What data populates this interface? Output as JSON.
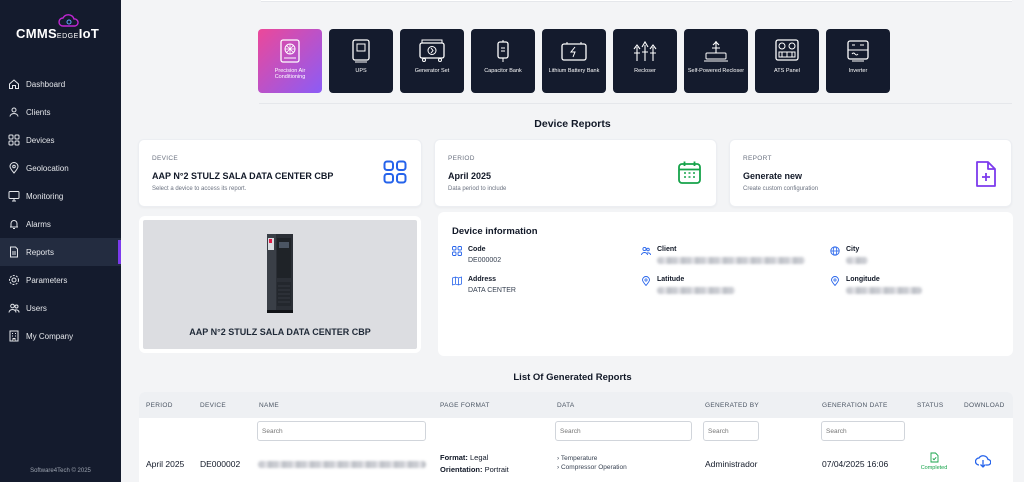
{
  "brand": {
    "name_left": "CMMS",
    "name_edge": "EDGE",
    "name_right": "IoT"
  },
  "sidebar": {
    "items": [
      {
        "label": "Dashboard",
        "icon": "home-icon"
      },
      {
        "label": "Clients",
        "icon": "clients-icon"
      },
      {
        "label": "Devices",
        "icon": "grid-icon"
      },
      {
        "label": "Geolocation",
        "icon": "location-pin-icon"
      },
      {
        "label": "Monitoring",
        "icon": "monitor-icon"
      },
      {
        "label": "Alarms",
        "icon": "alarm-icon"
      },
      {
        "label": "Reports",
        "icon": "file-icon",
        "active": true
      },
      {
        "label": "Parameters",
        "icon": "gear-icon"
      },
      {
        "label": "Users",
        "icon": "users-icon"
      },
      {
        "label": "My Company",
        "icon": "building-icon"
      }
    ],
    "footer": "Software4Tech © 2025"
  },
  "device_types": [
    {
      "label": "Precision Air Conditioning",
      "icon": "air-conditioning-icon",
      "active": true
    },
    {
      "label": "UPS",
      "icon": "ups-icon"
    },
    {
      "label": "Generator Set",
      "icon": "generator-icon"
    },
    {
      "label": "Capacitor Bank",
      "icon": "capacitor-icon"
    },
    {
      "label": "Lithium Battery Bank",
      "icon": "battery-icon"
    },
    {
      "label": "Recloser",
      "icon": "recloser-icon"
    },
    {
      "label": "Self-Powered Recloser",
      "icon": "self-powered-recloser-icon"
    },
    {
      "label": "ATS Panel",
      "icon": "ats-panel-icon"
    },
    {
      "label": "Inverter",
      "icon": "inverter-icon"
    }
  ],
  "reports": {
    "title": "Device Reports",
    "device_card": {
      "key": "DEVICE",
      "value": "AAP N°2 STULZ SALA DATA CENTER CBP",
      "sub": "Select a device to access its report."
    },
    "period_card": {
      "key": "PERIOD",
      "value": "April 2025",
      "sub": "Data period to include"
    },
    "report_card": {
      "key": "REPORT",
      "value": "Generate new",
      "sub": "Create custom configuration"
    }
  },
  "device_image_name": "AAP N°2 STULZ SALA DATA CENTER CBP",
  "device_info": {
    "title": "Device information",
    "code_label": "Code",
    "code_value": "DE000002",
    "client_label": "Client",
    "city_label": "City",
    "address_label": "Address",
    "address_value": "DATA CENTER",
    "latitude_label": "Latitude",
    "longitude_label": "Longitude"
  },
  "table": {
    "title": "List Of Generated Reports",
    "headers": [
      "PERIOD",
      "DEVICE",
      "NAME",
      "PAGE FORMAT",
      "DATA",
      "GENERATED BY",
      "GENERATION DATE",
      "STATUS",
      "DOWNLOAD"
    ],
    "search_placeholder": "Search",
    "row": {
      "period": "April 2025",
      "device": "DE000002",
      "format_label": "Format:",
      "format_value": "Legal",
      "orientation_label": "Orientation:",
      "orientation_value": "Portrait",
      "data": [
        "Temperature",
        "Compressor Operation"
      ],
      "generated_by": "Administrador",
      "generation_date": "07/04/2025 16:06",
      "status": "Completed"
    }
  },
  "colors": {
    "sidebar_bg": "#141b2d",
    "accent": "#7c3aed",
    "status_green": "#16a34a",
    "icon_blue": "#2563eb"
  }
}
